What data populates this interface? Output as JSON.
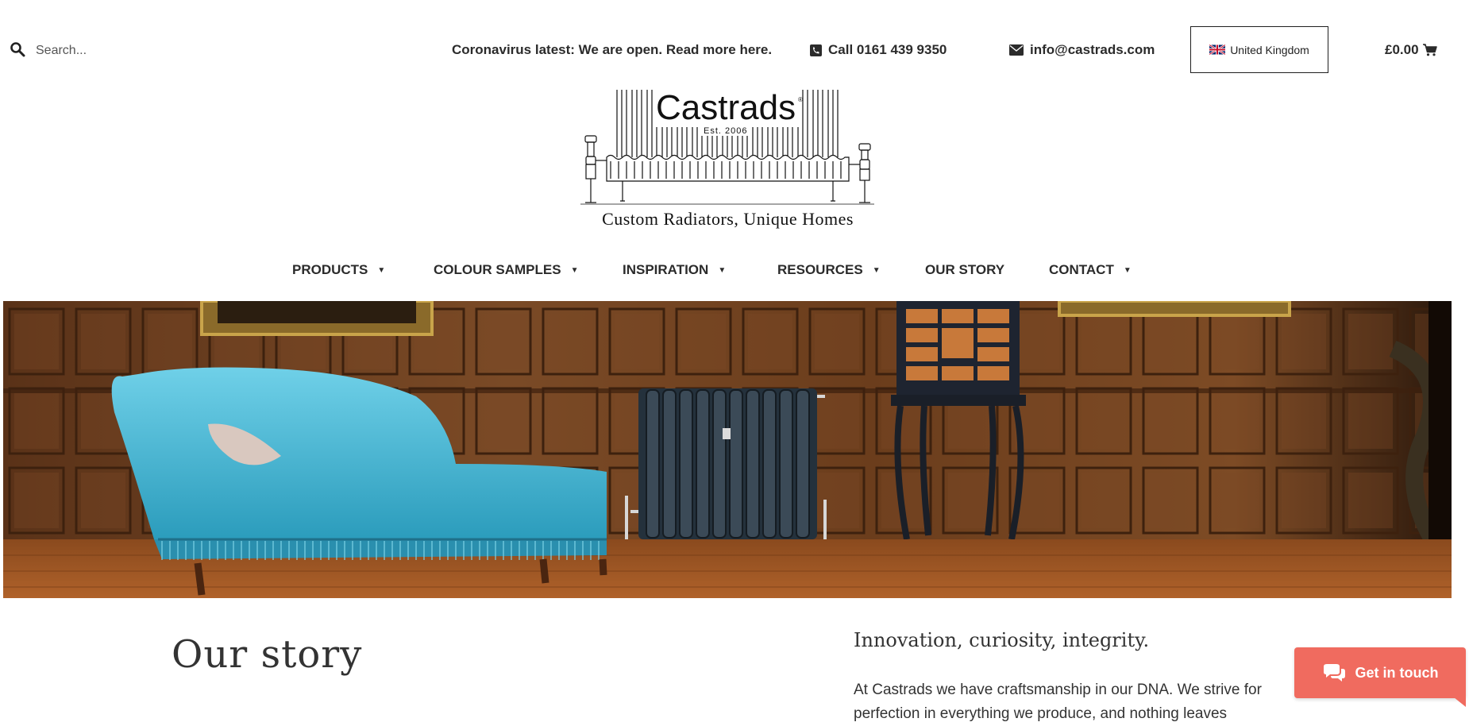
{
  "header": {
    "search": {
      "placeholder": "Search...",
      "icon": "search-icon"
    },
    "notice": "Coronavirus latest: We are open. Read more here.",
    "phone": {
      "icon": "phone-icon",
      "label": "Call 0161 439 9350"
    },
    "email": {
      "icon": "envelope-icon",
      "label": "info@castrads.com"
    },
    "country": {
      "icon": "uk-flag-icon",
      "label": "United Kingdom"
    },
    "cart": {
      "icon": "cart-icon",
      "label": "£0.00"
    }
  },
  "logo": {
    "brand": "Castrads",
    "registered": "®",
    "established": "Est. 2006",
    "tagline": "Custom Radiators, Unique Homes"
  },
  "nav": {
    "items": [
      {
        "label": "PRODUCTS",
        "caret": "▼"
      },
      {
        "label": "COLOUR SAMPLES",
        "caret": "▼"
      },
      {
        "label": "INSPIRATION",
        "caret": "▼"
      },
      {
        "label": "RESOURCES",
        "caret": "▼"
      },
      {
        "label": "OUR STORY"
      },
      {
        "label": "CONTACT",
        "caret": "▼"
      }
    ]
  },
  "story": {
    "title": "Our story",
    "subtitle": "Innovation, curiosity, integrity.",
    "body": "At Castrads we have craftsmanship in our DNA. We strive for perfection in everything we produce, and nothing leaves"
  },
  "chat": {
    "icon": "chat-icon",
    "label": "Get in touch",
    "color": "#f06b5f"
  },
  "colors": {
    "text": "#2b2b2b",
    "chat": "#f06b5f",
    "chaise": "#3fb6d3",
    "panelling": "#6b3d1c"
  }
}
